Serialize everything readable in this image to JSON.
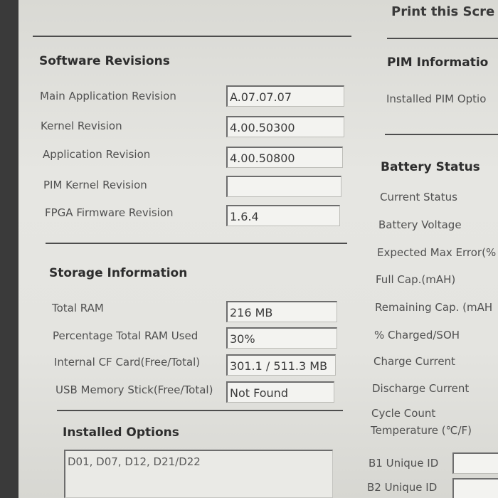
{
  "print_button": "Print this Scre",
  "software": {
    "title": "Software Revisions",
    "items": [
      {
        "label": "Main Application Revision",
        "value": "A.07.07.07"
      },
      {
        "label": "Kernel Revision",
        "value": "4.00.50300"
      },
      {
        "label": "Application Revision",
        "value": "4.00.50800"
      },
      {
        "label": "PIM Kernel Revision",
        "value": ""
      },
      {
        "label": "FPGA Firmware Revision",
        "value": "1.6.4"
      }
    ]
  },
  "storage": {
    "title": "Storage Information",
    "items": [
      {
        "label": "Total RAM",
        "value": "216 MB"
      },
      {
        "label": "Percentage Total RAM Used",
        "value": "30%"
      },
      {
        "label": "Internal CF Card(Free/Total)",
        "value": "301.1 / 511.3 MB"
      },
      {
        "label": "USB Memory Stick(Free/Total)",
        "value": "Not Found"
      }
    ]
  },
  "options": {
    "title": "Installed Options",
    "value": "D01, D07, D12, D21/D22"
  },
  "pim": {
    "title": "PIM Informatio",
    "label": "Installed PIM Optio"
  },
  "battery": {
    "title": "Battery Status",
    "labels": [
      "Current Status",
      "Battery Voltage",
      "Expected Max Error(%",
      "Full Cap.(mAH)",
      "Remaining Cap. (mAH",
      "% Charged/SOH",
      "Charge Current",
      "Discharge Current",
      "Cycle Count",
      "Temperature (℃/F)",
      "B1 Unique ID",
      "B2 Unique ID"
    ]
  }
}
